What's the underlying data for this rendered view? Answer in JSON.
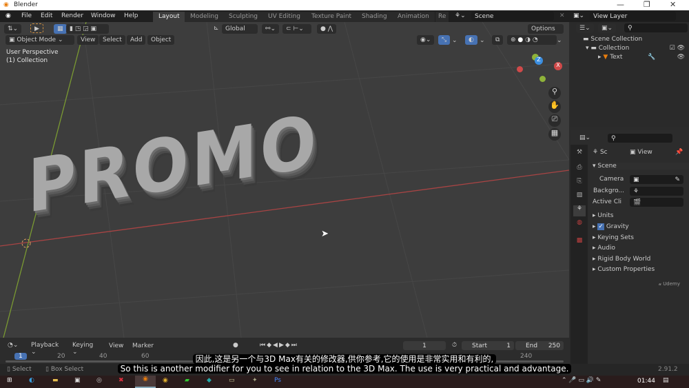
{
  "window": {
    "title": "Blender",
    "minimize": "—",
    "maximize": "❐",
    "close": "✕"
  },
  "menu": [
    "File",
    "Edit",
    "Render",
    "Window",
    "Help"
  ],
  "workspaces": [
    "Layout",
    "Modeling",
    "Sculpting",
    "UV Editing",
    "Texture Paint",
    "Shading",
    "Animation",
    "Re"
  ],
  "scene": {
    "name": "Scene",
    "view_layer": "View Layer"
  },
  "viewport": {
    "mode": "Object Mode",
    "menus": [
      "View",
      "Select",
      "Add",
      "Object"
    ],
    "orientation": "Global",
    "options": "Options",
    "overlay_line1": "User Perspective",
    "overlay_line2": "(1) Collection",
    "text_object": "PROMO",
    "gizmo": {
      "x": "X",
      "y": "Y",
      "z": "Z"
    }
  },
  "outliner": {
    "scene_collection": "Scene Collection",
    "collection": "Collection",
    "item": "Text"
  },
  "properties": {
    "scene_short": "Sc",
    "view": "View",
    "section": "Scene",
    "camera": "Camera",
    "background": "Backgro...",
    "active_clip": "Active Cli",
    "panels": [
      "Units",
      "Gravity",
      "Keying Sets",
      "Audio",
      "Rigid Body World",
      "Custom Properties"
    ],
    "gravity_checked": true,
    "watermark": "Udemy"
  },
  "timeline": {
    "menus": [
      "Playback",
      "Keying",
      "View",
      "Marker"
    ],
    "current_frame": "1",
    "start_label": "Start",
    "start": "1",
    "end_label": "End",
    "end": "250",
    "ticks": [
      "1",
      "20",
      "40",
      "60",
      "240"
    ]
  },
  "status": {
    "select": "Select",
    "box_select": "Box Select",
    "version": "2.91.2"
  },
  "subtitles": {
    "zh": "因此,这是另一个与3D Max有关的修改器,供你参考,它的使用是非常实用和有利的,",
    "en": "So this is another modifier for you to see in relation to the 3D Max. The use is very practical and advantage."
  },
  "taskbar": {
    "time": "01:44"
  },
  "colors": {
    "accent": "#4772b3",
    "x_axis": "#d04a4a",
    "y_axis": "#8fb33a",
    "orange": "#e87d0d"
  }
}
